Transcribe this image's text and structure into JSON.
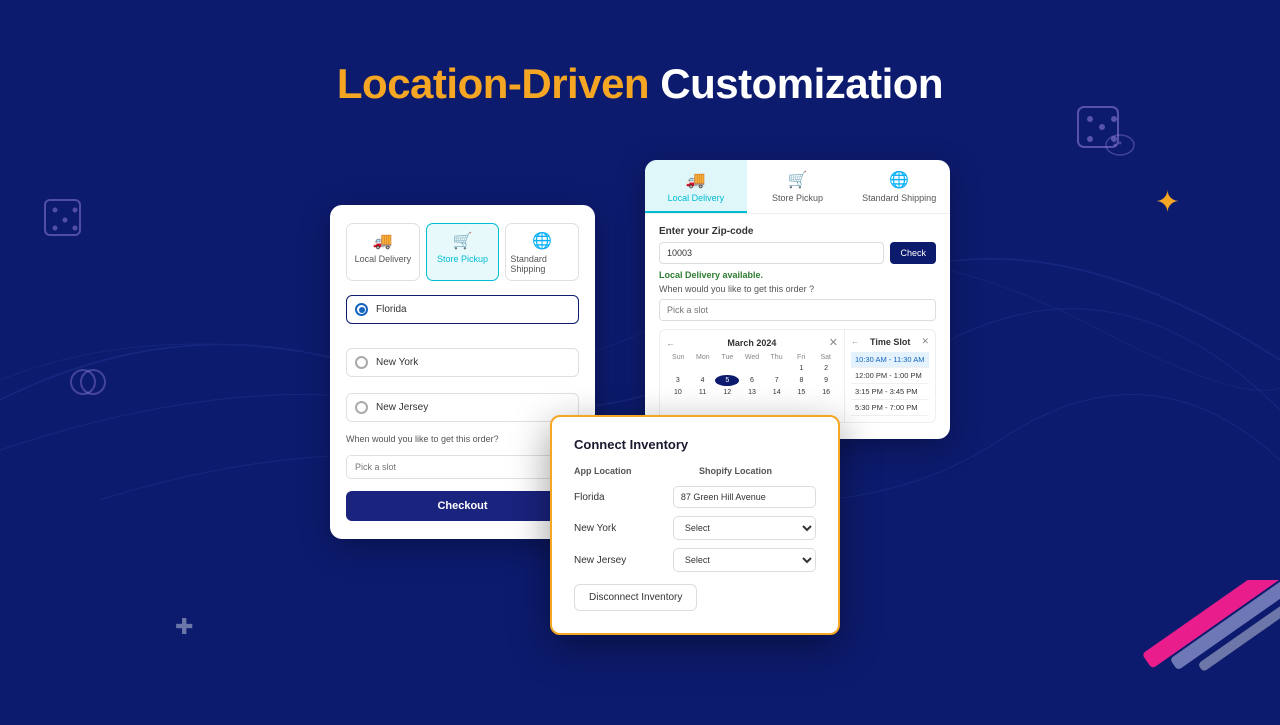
{
  "page": {
    "title_orange": "Location-Driven",
    "title_white": "Customization",
    "bg_color": "#0d1b6e"
  },
  "left_card": {
    "tabs": [
      {
        "label": "Local Delivery",
        "icon": "🚚",
        "active": false
      },
      {
        "label": "Store Pickup",
        "icon": "🛒",
        "active": true
      },
      {
        "label": "Standard Shipping",
        "icon": "🌐",
        "active": false
      }
    ],
    "locations": [
      {
        "name": "Florida",
        "selected": true
      },
      {
        "name": "New York",
        "selected": false
      },
      {
        "name": "New Jersey",
        "selected": false
      }
    ],
    "when_label": "When would you like to get this order?",
    "slot_placeholder": "Pick a slot",
    "checkout_label": "Checkout"
  },
  "right_card": {
    "tabs": [
      {
        "label": "Local Delivery",
        "icon": "🚚",
        "active": true
      },
      {
        "label": "Store Pickup",
        "icon": "🛒",
        "active": false
      },
      {
        "label": "Standard Shipping",
        "icon": "🌐",
        "active": false
      }
    ],
    "zip_label": "Enter your Zip-code",
    "zip_value": "10003",
    "check_btn": "Check",
    "available_text": "Local Delivery available.",
    "when_order_label": "When would you like to get this order ?",
    "slot_placeholder": "Pick a slot",
    "calendar": {
      "month": "March 2024",
      "day_headers": [
        "Sun",
        "Mon",
        "Tue",
        "Wed",
        "Thu",
        "Fri",
        "Sat"
      ],
      "days": [
        [
          "",
          "",
          "",
          "",
          "",
          "1",
          "2"
        ],
        [
          "3",
          "4",
          "5",
          "6",
          "7",
          "8",
          "9"
        ],
        [
          "10",
          "11",
          "12",
          "13",
          "14",
          "15",
          "16"
        ]
      ],
      "active_day": "5"
    },
    "timeslots": {
      "title": "Time Slot",
      "items": [
        {
          "label": "10:30 AM - 11:30 AM",
          "selected": true
        },
        {
          "label": "12:00 PM - 1:00 PM",
          "selected": false
        },
        {
          "label": "3:15 PM - 3:45 PM",
          "selected": false
        },
        {
          "label": "5:30 PM - 7:00 PM",
          "selected": false
        }
      ]
    }
  },
  "modal": {
    "title": "Connect Inventory",
    "col_app": "App Location",
    "col_shopify": "Shopify Location",
    "rows": [
      {
        "location": "Florida",
        "value": "87 Green Hill Avenue",
        "is_input": true
      },
      {
        "location": "New York",
        "value": "Select",
        "is_input": false
      },
      {
        "location": "New Jersey",
        "value": "Select",
        "is_input": false
      }
    ],
    "disconnect_btn": "Disconnect Inventory"
  }
}
